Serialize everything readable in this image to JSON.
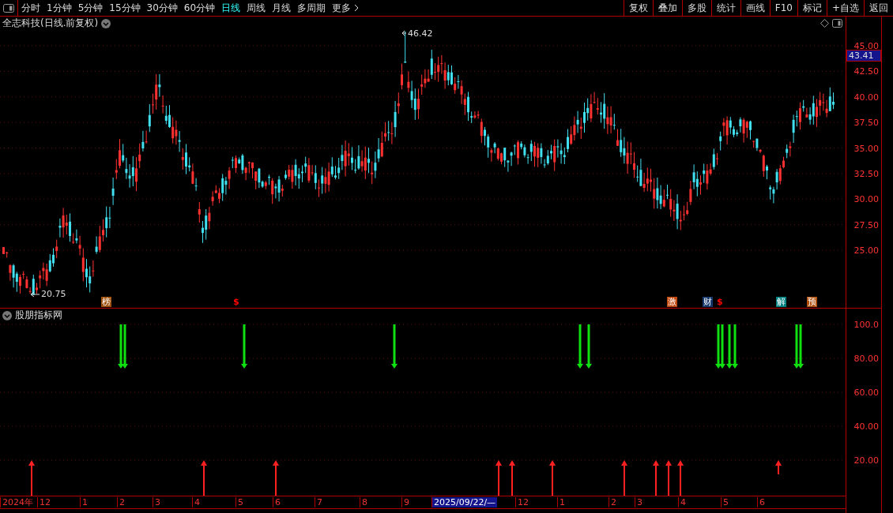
{
  "toolbar": {
    "periods": [
      {
        "label": "分时",
        "selected": false
      },
      {
        "label": "1分钟",
        "selected": false
      },
      {
        "label": "5分钟",
        "selected": false
      },
      {
        "label": "15分钟",
        "selected": false
      },
      {
        "label": "30分钟",
        "selected": false
      },
      {
        "label": "60分钟",
        "selected": false
      },
      {
        "label": "日线",
        "selected": true
      },
      {
        "label": "周线",
        "selected": false
      },
      {
        "label": "月线",
        "selected": false
      },
      {
        "label": "多周期",
        "selected": false
      }
    ],
    "more": "更多",
    "actions": [
      "复权",
      "叠加",
      "多股",
      "统计",
      "画线",
      "F10",
      "标记",
      "+自选",
      "返回"
    ]
  },
  "main_chart": {
    "title": "全志科技(日线.前复权)",
    "high_label": "46.42",
    "low_label": "20.75",
    "price_ticks": [
      "45.00",
      "42.50",
      "40.00",
      "37.50",
      "35.00",
      "32.50",
      "30.00",
      "27.50",
      "25.00"
    ],
    "current_price": "43.41",
    "events": [
      {
        "kind": "tag",
        "label": "榜",
        "color": "#a0520f"
      },
      {
        "kind": "dollar",
        "label": "$",
        "color": "#ff0000"
      },
      {
        "kind": "tag",
        "label": "激",
        "color": "#c0480f"
      },
      {
        "kind": "tag",
        "label": "财",
        "color": "#17386a"
      },
      {
        "kind": "dollar",
        "label": "$",
        "color": "#ff0000"
      },
      {
        "kind": "tag",
        "label": "解",
        "color": "#008080"
      },
      {
        "kind": "tag",
        "label": "预",
        "color": "#b0500f"
      }
    ]
  },
  "indicator": {
    "title": "股朋指标网",
    "ticks": [
      "100.0",
      "80.00",
      "60.00",
      "40.00",
      "20.00"
    ]
  },
  "date_axis": [
    {
      "label": "2024年",
      "selected": false
    },
    {
      "label": "12",
      "selected": false
    },
    {
      "label": "1",
      "selected": false
    },
    {
      "label": "2",
      "selected": false
    },
    {
      "label": "3",
      "selected": false
    },
    {
      "label": "4",
      "selected": false
    },
    {
      "label": "5",
      "selected": false
    },
    {
      "label": "6",
      "selected": false
    },
    {
      "label": "7",
      "selected": false
    },
    {
      "label": "8",
      "selected": false
    },
    {
      "label": "9",
      "selected": false
    },
    {
      "label": "2025/09/22/—",
      "selected": true
    },
    {
      "label": "12",
      "selected": false
    },
    {
      "label": "1",
      "selected": false
    },
    {
      "label": "2",
      "selected": false
    },
    {
      "label": "3",
      "selected": false
    },
    {
      "label": "4",
      "selected": false
    },
    {
      "label": "5",
      "selected": false
    },
    {
      "label": "6",
      "selected": false
    }
  ]
}
